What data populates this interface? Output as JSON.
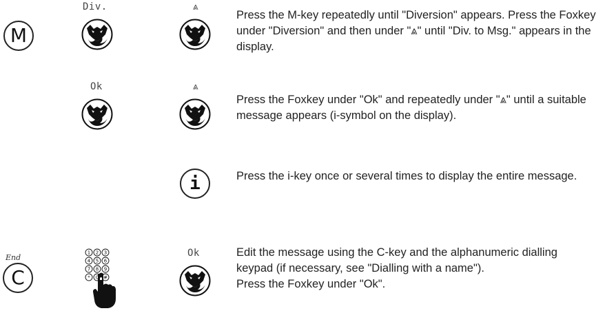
{
  "steps": [
    {
      "keys": {
        "m_key": "M"
      },
      "labels": {
        "div": "Div.",
        "scroll": "⩓"
      },
      "text": "Press the M-key repeatedly until \"Diversion\" appears. Press the Foxkey under \"Diversion\" and then under \"⩓\" until \"Div. to Msg.\" appears in the display."
    },
    {
      "labels": {
        "ok": "Ok",
        "scroll": "⩓"
      },
      "text": "Press the Foxkey under \"Ok\" and repeatedly under \"⩓\" until a suitable message appears (i-symbol on the display)."
    },
    {
      "keys": {
        "i_key": "i"
      },
      "text": "Press the i-key once or several times to display the entire message."
    },
    {
      "keys": {
        "c_key": "C",
        "end_label": "End"
      },
      "labels": {
        "ok": "Ok"
      },
      "text_lines": [
        "Edit the message using the C-key and the alphanumeric dialling keypad (if necessary, see \"Dialling with a name\").",
        "Press the Foxkey under \"Ok\"."
      ]
    }
  ],
  "keypad_digits": [
    "1",
    "2",
    "3",
    "4",
    "5",
    "6",
    "7",
    "8",
    "9",
    "*",
    "0",
    "#"
  ],
  "icons": {
    "foxkey": "fox-icon",
    "keypad": "keypad-icon",
    "hand": "hand-icon"
  }
}
